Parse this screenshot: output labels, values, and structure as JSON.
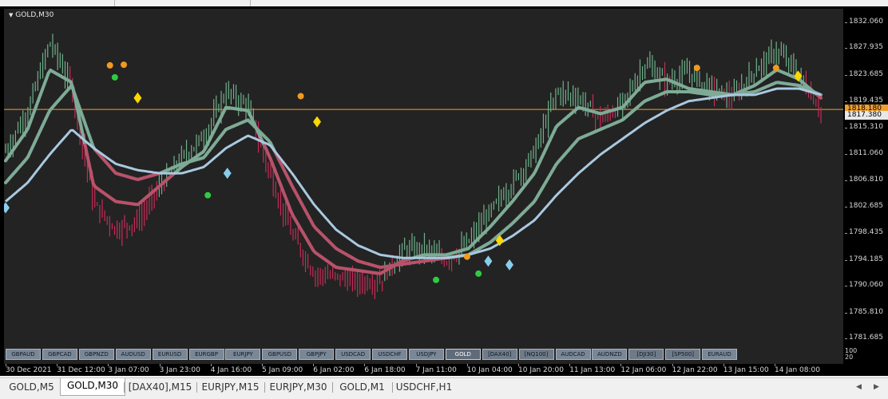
{
  "window": {
    "symbol_title": "GOLD,M30"
  },
  "colors": {
    "plot_bg": "#232323",
    "bull_bar": "#6fb08a",
    "bear_bar": "#c42c57",
    "ribbon_green": "#7eab96",
    "ribbon_red": "#b8526a",
    "ribbon_yellow": "#e6c23a",
    "ma_blue": "#a9c9e0",
    "hline": "#f0a030",
    "marker_orange": "#f39a1e",
    "marker_green": "#2ecc40",
    "marker_diamond_gold": "#ffd700",
    "marker_diamond_blue": "#87ceeb"
  },
  "price_axis": {
    "labels": [
      "1832.060",
      "1827.935",
      "1823.685",
      "1819.435",
      "1815.310",
      "1811.060",
      "1806.810",
      "1802.685",
      "1798.435",
      "1794.185",
      "1790.060",
      "1785.810",
      "1781.685"
    ],
    "current_price": "1817.380",
    "hline_price": "1818.180",
    "hline_label": "1818.180"
  },
  "time_axis": {
    "labels": [
      "30 Dec 2021",
      "31 Dec 12:00",
      "3 Jan 07:00",
      "3 Jan 23:00",
      "4 Jan 16:00",
      "5 Jan 09:00",
      "6 Jan 02:00",
      "6 Jan 18:00",
      "7 Jan 11:00",
      "10 Jan 04:00",
      "10 Jan 20:00",
      "11 Jan 13:00",
      "12 Jan 06:00",
      "12 Jan 22:00",
      "13 Jan 15:00",
      "14 Jan 08:00"
    ]
  },
  "symbol_panel": {
    "buttons": [
      {
        "label": "GBPAUD"
      },
      {
        "label": "GBPCAD"
      },
      {
        "label": "GBPNZD"
      },
      {
        "label": "AUDUSD"
      },
      {
        "label": "EURUSD"
      },
      {
        "label": "EURGBP"
      },
      {
        "label": "EURJPY"
      },
      {
        "label": "GBPUSD"
      },
      {
        "label": "GBPJPY"
      },
      {
        "label": "USDCAD"
      },
      {
        "label": "USDCHF"
      },
      {
        "label": "USDJPY"
      },
      {
        "label": "GOLD",
        "active": true
      },
      {
        "label": "[DAX40]"
      },
      {
        "label": "[NQ100]"
      },
      {
        "label": "AUDCAD"
      },
      {
        "label": "AUDNZD"
      },
      {
        "label": "[DJI30]"
      },
      {
        "label": "[SP500]"
      },
      {
        "label": "EURAUD"
      }
    ],
    "scale": [
      "100",
      "20"
    ]
  },
  "tabs": [
    {
      "label": "GOLD,M5"
    },
    {
      "label": "GOLD,M30",
      "active": true
    },
    {
      "label": "[DAX40],M15"
    },
    {
      "label": "EURJPY,M15"
    },
    {
      "label": "EURJPY,M30"
    },
    {
      "label": "GOLD,M1"
    },
    {
      "label": "USDCHF,H1"
    }
  ],
  "chart_data": {
    "type": "candlestick-with-indicators",
    "symbol": "GOLD",
    "timeframe": "M30",
    "ylim": [
      1781.685,
      1832.06
    ],
    "x_categories": [
      "30 Dec 2021",
      "31 Dec 12:00",
      "3 Jan 07:00",
      "3 Jan 23:00",
      "4 Jan 16:00",
      "5 Jan 09:00",
      "6 Jan 02:00",
      "6 Jan 18:00",
      "7 Jan 11:00",
      "10 Jan 04:00",
      "10 Jan 20:00",
      "11 Jan 13:00",
      "12 Jan 06:00",
      "12 Jan 22:00",
      "13 Jan 15:00",
      "14 Jan 08:00"
    ],
    "series": [
      {
        "role": "price-close",
        "values": [
          1811.5,
          1818.0,
          1829.0,
          1821.5,
          1803.0,
          1799.0,
          1800.5,
          1806.0,
          1810.5,
          1814.0,
          1821.0,
          1818.5,
          1807.5,
          1798.0,
          1792.0,
          1791.5,
          1790.5,
          1791.0,
          1795.5,
          1796.0,
          1794.0,
          1797.0,
          1802.0,
          1806.5,
          1811.5,
          1821.0,
          1820.0,
          1816.5,
          1819.0,
          1825.5,
          1822.5,
          1824.0,
          1821.5,
          1820.0,
          1824.5,
          1827.5,
          1823.5,
          1818.0
        ]
      },
      {
        "role": "fast-ema",
        "values": [
          1810.0,
          1815.0,
          1824.5,
          1822.5,
          1806.0,
          1803.5,
          1803.0,
          1806.0,
          1809.0,
          1811.5,
          1818.5,
          1818.0,
          1810.5,
          1801.5,
          1795.5,
          1793.0,
          1792.5,
          1792.0,
          1794.0,
          1795.0,
          1795.0,
          1796.0,
          1799.5,
          1803.5,
          1808.0,
          1815.5,
          1818.5,
          1817.5,
          1818.5,
          1822.5,
          1823.0,
          1821.5,
          1821.0,
          1820.5,
          1822.0,
          1824.5,
          1823.0,
          1820.0
        ]
      },
      {
        "role": "slow-ema",
        "values": [
          1806.5,
          1810.5,
          1818.0,
          1822.0,
          1812.0,
          1808.0,
          1807.0,
          1808.0,
          1809.5,
          1810.5,
          1815.0,
          1816.5,
          1813.0,
          1806.0,
          1799.5,
          1796.0,
          1794.0,
          1793.0,
          1793.5,
          1794.0,
          1794.5,
          1795.0,
          1797.0,
          1800.0,
          1803.5,
          1809.5,
          1813.5,
          1815.0,
          1816.5,
          1819.5,
          1821.0,
          1821.0,
          1820.5,
          1820.5,
          1821.0,
          1822.5,
          1822.0,
          1820.5
        ]
      },
      {
        "role": "base-ma",
        "values": [
          1803.5,
          1806.5,
          1811.0,
          1815.0,
          1812.0,
          1809.5,
          1808.5,
          1808.0,
          1808.0,
          1809.0,
          1812.0,
          1814.0,
          1812.5,
          1808.0,
          1803.0,
          1799.0,
          1796.5,
          1795.0,
          1794.5,
          1794.5,
          1794.5,
          1795.0,
          1796.0,
          1798.0,
          1800.5,
          1804.5,
          1808.0,
          1811.0,
          1813.5,
          1816.0,
          1818.0,
          1819.5,
          1820.0,
          1820.5,
          1820.5,
          1821.5,
          1821.5,
          1820.5
        ]
      }
    ]
  }
}
